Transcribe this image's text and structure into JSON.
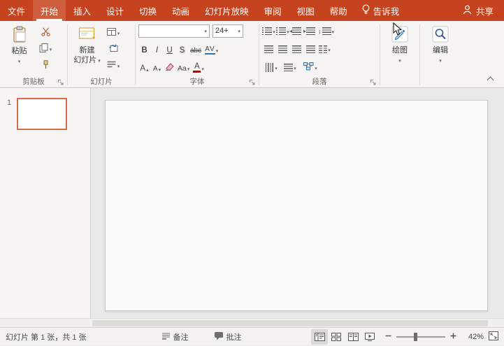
{
  "colors": {
    "brand_red": "#C5441F",
    "selected_thumb_border": "#DE6A4C",
    "ribbon_bg": "#F5F4F2",
    "canvas_bg": "#E9E9E9",
    "statusbar_bg": "#F3F2F1",
    "font_color_swatch": "#C00000"
  },
  "titlebar": {
    "menus": [
      {
        "label": "文件"
      },
      {
        "label": "开始",
        "selected": true
      },
      {
        "label": "插入"
      },
      {
        "label": "设计"
      },
      {
        "label": "切换"
      },
      {
        "label": "动画"
      },
      {
        "label": "幻灯片放映"
      },
      {
        "label": "审阅"
      },
      {
        "label": "视图"
      },
      {
        "label": "帮助"
      }
    ],
    "tell_me": "告诉我",
    "share": "共享"
  },
  "ribbon": {
    "clipboard": {
      "group_label": "剪贴板",
      "paste": "粘贴"
    },
    "slides": {
      "group_label": "幻灯片",
      "new_slide_line1": "新建",
      "new_slide_line2": "幻灯片"
    },
    "font": {
      "group_label": "字体",
      "font_name_value": "",
      "font_size_value": "24+",
      "bold": "B",
      "italic": "I",
      "underline": "U",
      "shadow": "S",
      "strikethrough": "abc",
      "char_spacing": "AV",
      "grow_font": "A",
      "shrink_font": "A",
      "change_case": "Aa",
      "font_color": "A"
    },
    "paragraph": {
      "group_label": "段落"
    },
    "drawing_label": "绘图",
    "editing_label": "编辑"
  },
  "slide_panel": {
    "slide_number": "1"
  },
  "statusbar": {
    "slide_info": "幻灯片 第 1 张，共 1 张",
    "notes_label": "备注",
    "comments_label": "批注",
    "zoom_value": "42%"
  }
}
